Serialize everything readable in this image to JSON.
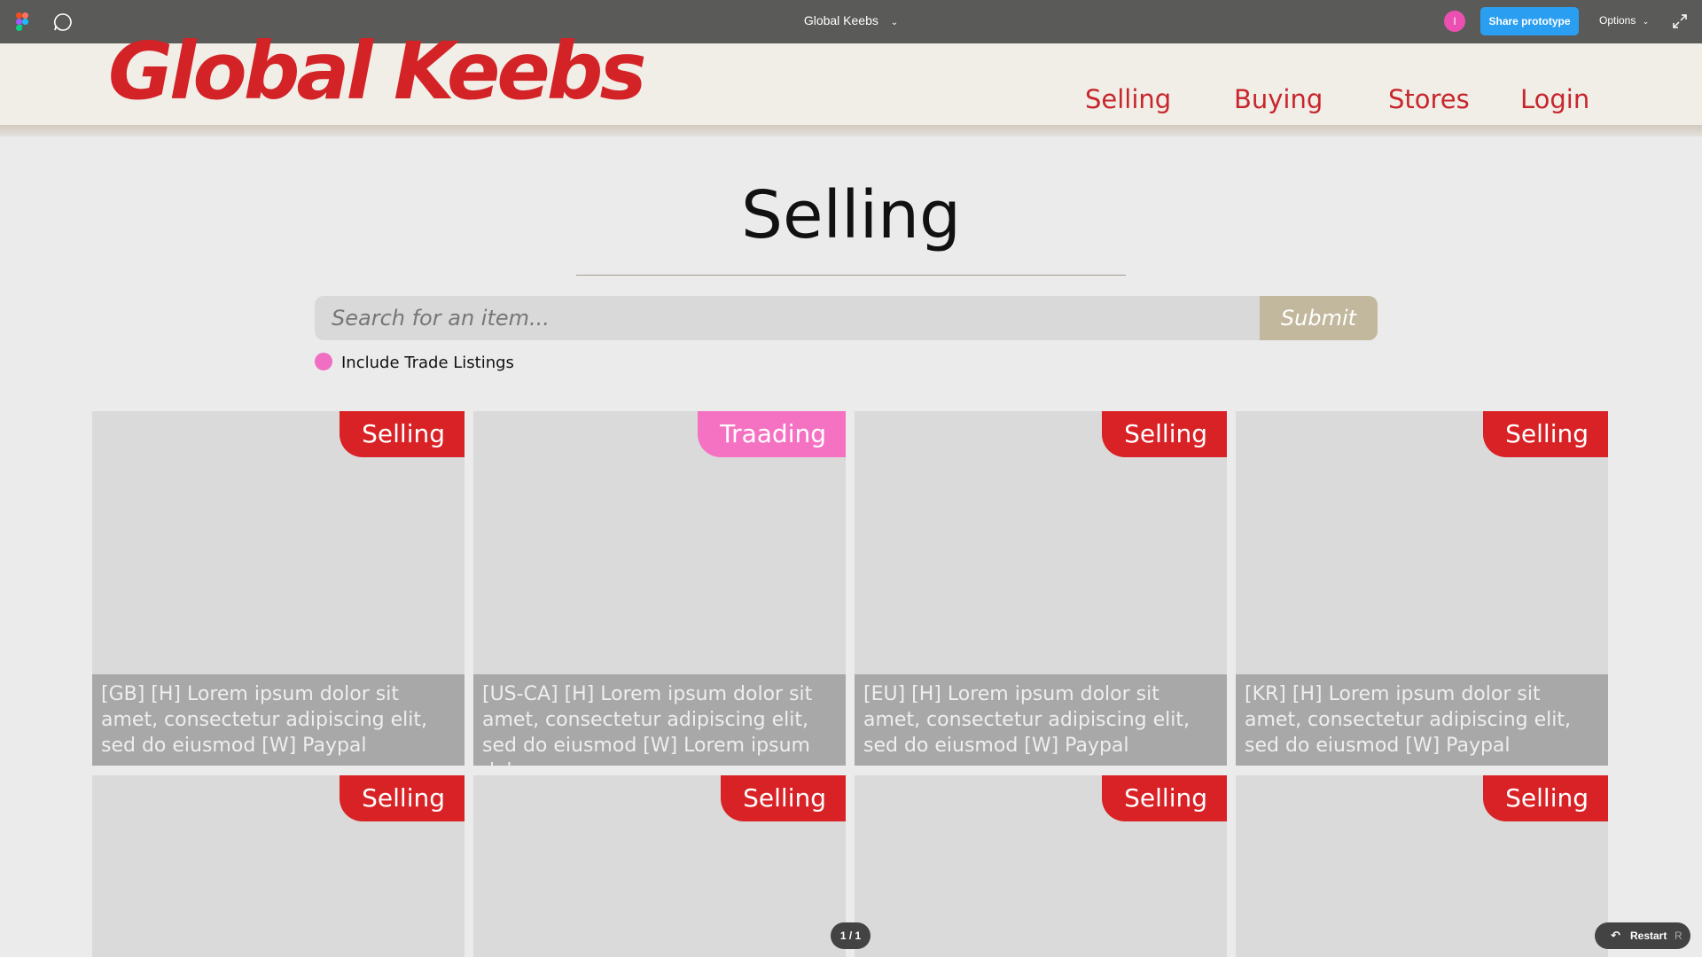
{
  "figma": {
    "file_title": "Global Keebs",
    "avatar_initial": "I",
    "share_label": "Share prototype",
    "options_label": "Options",
    "page_counter": "1 / 1",
    "restart_label": "Restart",
    "restart_key": "R"
  },
  "site": {
    "logo": "Global Keebs",
    "nav": [
      "Selling",
      "Buying",
      "Stores",
      "Login"
    ]
  },
  "page": {
    "title": "Selling",
    "search_placeholder": "Search for an item...",
    "submit_label": "Submit",
    "trade_toggle_label": "Include Trade Listings"
  },
  "listings": [
    {
      "badge": "Selling",
      "type": "sell",
      "caption": "[GB] [H] Lorem ipsum dolor sit amet, consectetur adipiscing elit, sed do eiusmod [W] Paypal"
    },
    {
      "badge": "Traading",
      "type": "trade",
      "caption": "[US-CA] [H] Lorem ipsum dolor sit amet, consectetur adipiscing elit, sed do eiusmod [W] Lorem ipsum dolor"
    },
    {
      "badge": "Selling",
      "type": "sell",
      "caption": "[EU] [H] Lorem ipsum dolor sit amet, consectetur adipiscing elit, sed do eiusmod [W] Paypal"
    },
    {
      "badge": "Selling",
      "type": "sell",
      "caption": "[KR] [H] Lorem ipsum dolor sit amet, consectetur adipiscing elit, sed do eiusmod [W] Paypal"
    },
    {
      "badge": "Selling",
      "type": "sell",
      "caption": ""
    },
    {
      "badge": "Selling",
      "type": "sell",
      "caption": ""
    },
    {
      "badge": "Selling",
      "type": "sell",
      "caption": ""
    },
    {
      "badge": "Selling",
      "type": "sell",
      "caption": ""
    }
  ],
  "colors": {
    "brand_red": "#d32327",
    "trade_pink": "#f571c2",
    "figma_blue": "#2a9ef0"
  }
}
